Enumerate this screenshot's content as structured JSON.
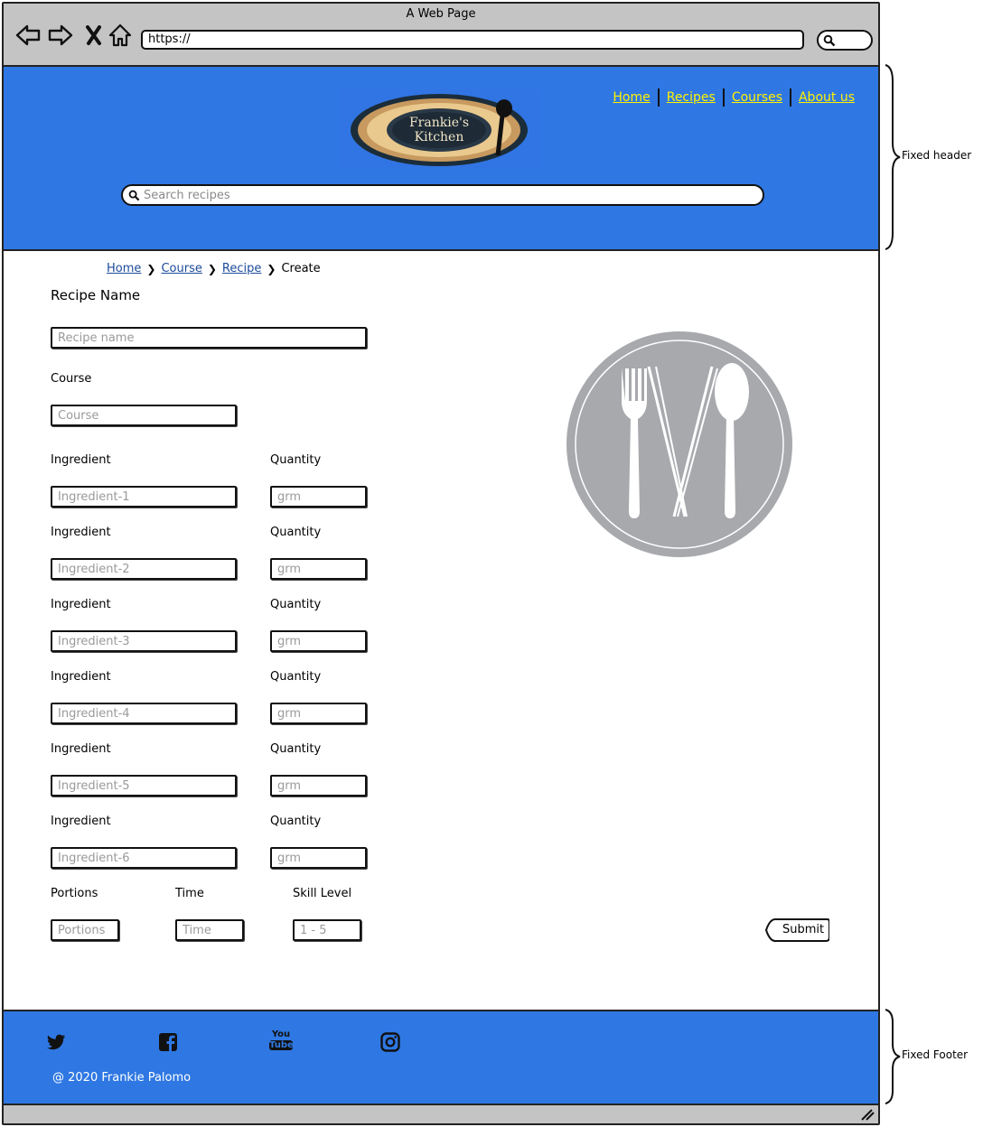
{
  "browser": {
    "window_title": "A Web Page",
    "url": "https://"
  },
  "header": {
    "logo_text": "Frankie's Kitchen",
    "nav": [
      {
        "label": "Home"
      },
      {
        "label": "Recipes"
      },
      {
        "label": "Courses"
      },
      {
        "label": "About us"
      }
    ],
    "search_placeholder": "Search recipes"
  },
  "breadcrumb": {
    "items": [
      "Home",
      "Course",
      "Recipe"
    ],
    "current": "Create"
  },
  "form": {
    "recipe_name_label": "Recipe Name",
    "recipe_name_placeholder": "Recipe name",
    "course_label": "Course",
    "course_placeholder": "Course",
    "ingredient_label": "Ingredient",
    "quantity_label": "Quantity",
    "ingredients": [
      {
        "placeholder": "Ingredient-1",
        "quantity_placeholder": "grm"
      },
      {
        "placeholder": "Ingredient-2",
        "quantity_placeholder": "grm"
      },
      {
        "placeholder": "Ingredient-3",
        "quantity_placeholder": "grm"
      },
      {
        "placeholder": "Ingredient-4",
        "quantity_placeholder": "grm"
      },
      {
        "placeholder": "Ingredient-5",
        "quantity_placeholder": "grm"
      },
      {
        "placeholder": "Ingredient-6",
        "quantity_placeholder": "grm"
      }
    ],
    "portions_label": "Portions",
    "portions_placeholder": "Portions",
    "time_label": "Time",
    "time_placeholder": "Time",
    "skill_label": "Skill Level",
    "skill_placeholder": "1 - 5",
    "submit_label": "Submit"
  },
  "footer": {
    "social_icons": [
      "twitter-icon",
      "facebook-icon",
      "youtube-icon",
      "instagram-icon"
    ],
    "youtube_text_top": "You",
    "youtube_text_bottom": "Tube",
    "copyright": "@ 2020 Frankie Palomo"
  },
  "annotations": {
    "header_note": "Fixed header",
    "footer_note": "Fixed Footer"
  },
  "colors": {
    "header_bg": "#2f78e3",
    "nav_link": "#fff200",
    "chrome_bg": "#c4c4c4",
    "placeholder_graphic": "#a7a9ad"
  }
}
